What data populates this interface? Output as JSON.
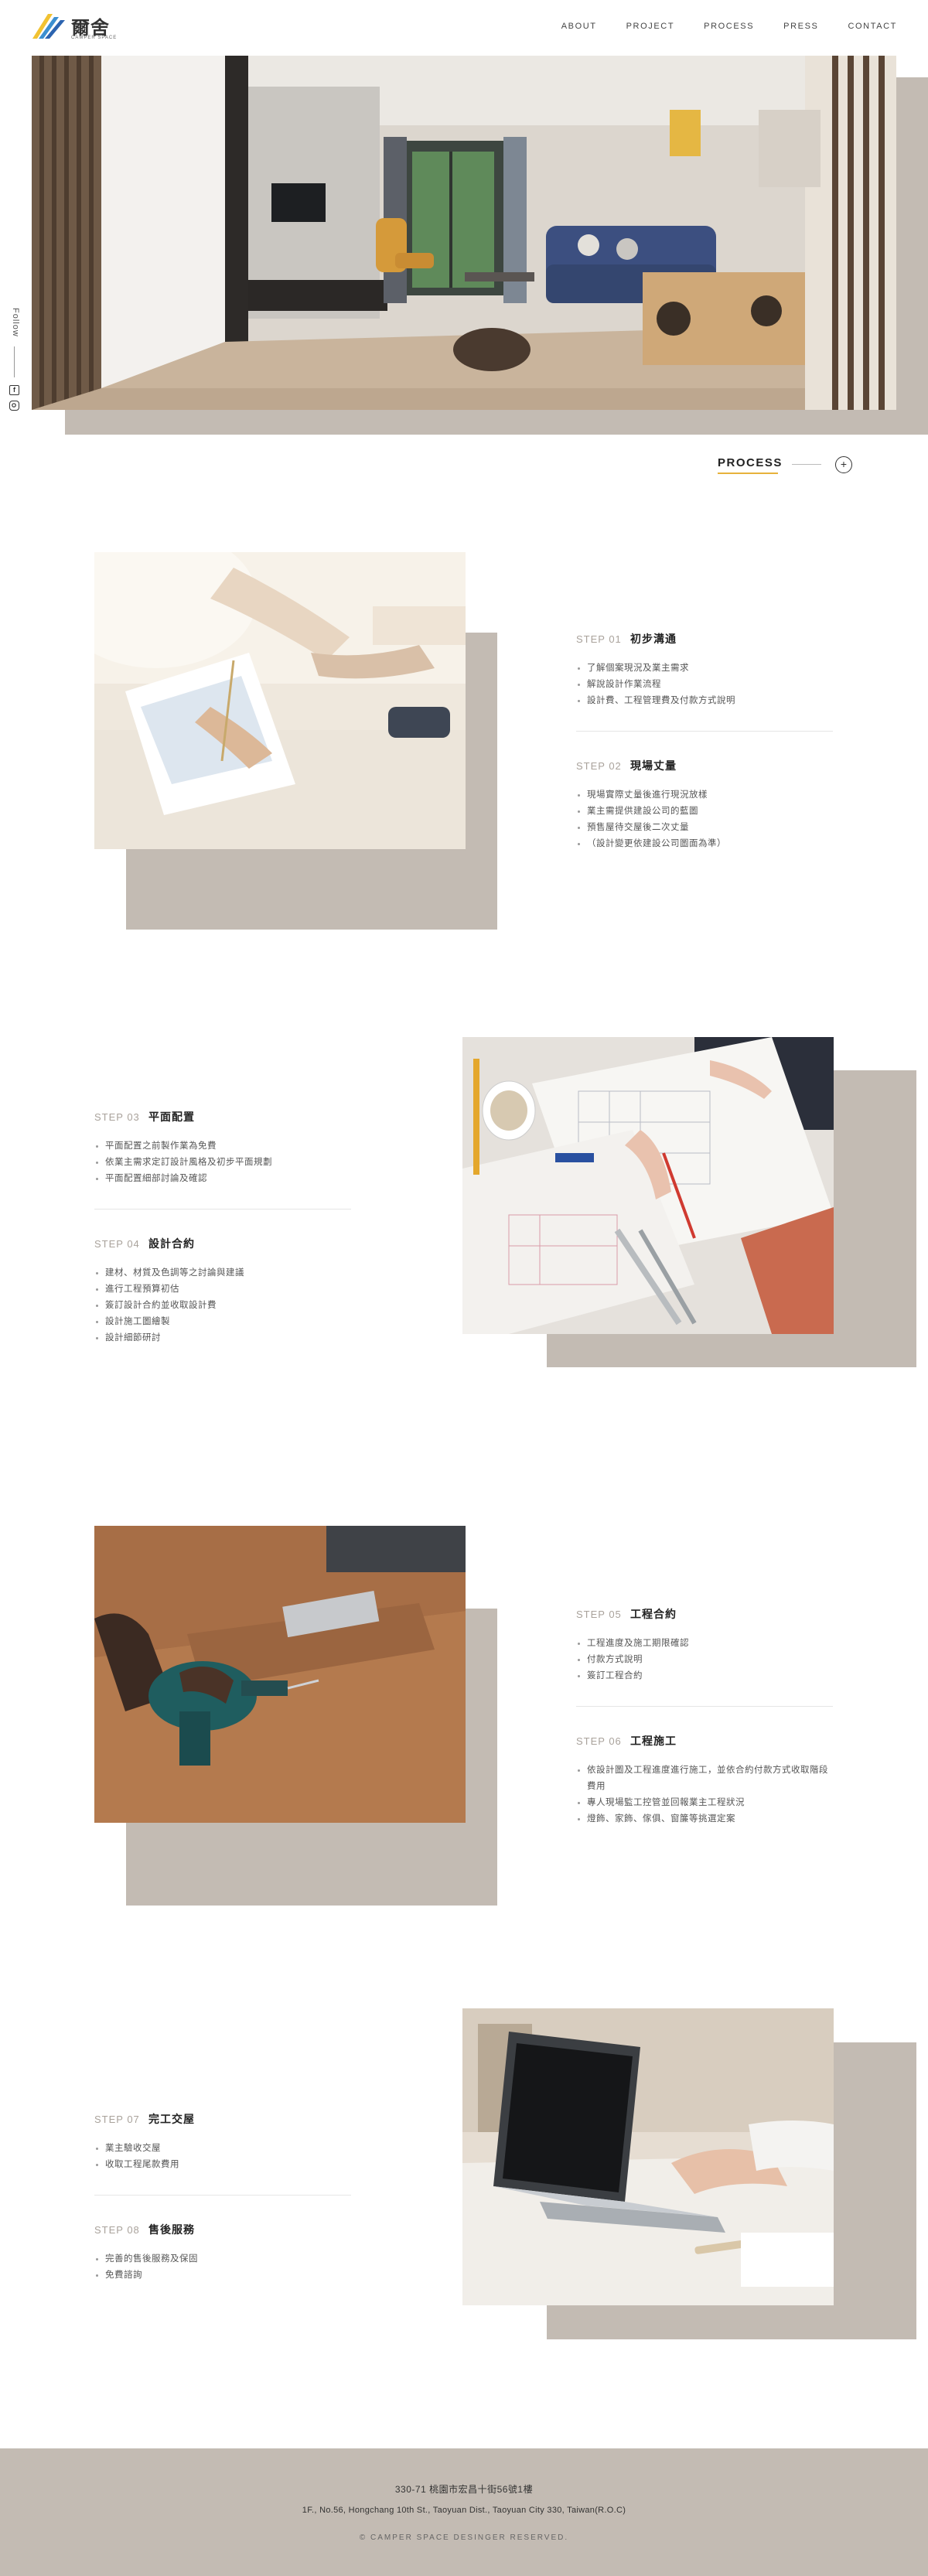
{
  "brand": {
    "name": "爾舍",
    "tagline": "CAMPER SPACE"
  },
  "nav": [
    "ABOUT",
    "PROJECT",
    "PROCESS",
    "PRESS",
    "CONTACT"
  ],
  "social": {
    "follow": "Follow"
  },
  "process": {
    "title": "PROCESS",
    "toggle": "+"
  },
  "blocks": [
    {
      "steps": [
        {
          "no": "STEP 01",
          "name": "初步溝通",
          "items": [
            "了解個案現況及業主需求",
            "解說設計作業流程",
            "設計費、工程管理費及付款方式說明"
          ]
        },
        {
          "no": "STEP 02",
          "name": "現場丈量",
          "items": [
            "現場實際丈量後進行現況放樣",
            "業主需提供建設公司的藍圖",
            "預售屋待交屋後二次丈量",
            "（設計變更依建設公司圖面為準）"
          ]
        }
      ]
    },
    {
      "steps": [
        {
          "no": "STEP 03",
          "name": "平面配置",
          "items": [
            "平面配置之前製作業為免費",
            "依業主需求定訂設計風格及初步平面規劃",
            "平面配置細部討論及確認"
          ]
        },
        {
          "no": "STEP 04",
          "name": "設計合約",
          "items": [
            "建材、材質及色調等之討論與建議",
            "進行工程預算初估",
            "簽訂設計合約並收取設計費",
            "設計施工圖繪製",
            "設計細節研討"
          ]
        }
      ]
    },
    {
      "steps": [
        {
          "no": "STEP 05",
          "name": "工程合約",
          "items": [
            "工程進度及施工期限確認",
            "付款方式說明",
            "簽訂工程合約"
          ]
        },
        {
          "no": "STEP 06",
          "name": "工程施工",
          "items": [
            "依設計圖及工程進度進行施工，並依合約付款方式收取階段費用",
            "專人現場監工控管並回報業主工程狀況",
            "燈飾、家飾、傢俱、窗簾等挑選定案"
          ]
        }
      ]
    },
    {
      "steps": [
        {
          "no": "STEP 07",
          "name": "完工交屋",
          "items": [
            "業主驗收交屋",
            "收取工程尾款費用"
          ]
        },
        {
          "no": "STEP 08",
          "name": "售後服務",
          "items": [
            "完善的售後服務及保固",
            "免費諮詢"
          ]
        }
      ]
    }
  ],
  "footer": {
    "address_zh": "330-71 桃園市宏昌十街56號1樓",
    "address_en": "1F., No.56, Hongchang 10th St., Taoyuan Dist., Taoyuan City 330, Taiwan(R.O.C)",
    "copyright": "© CAMPER SPACE DESINGER RESERVED."
  },
  "colors": {
    "accent": "#e7b23b",
    "shadow": "#c3bbb3",
    "step_no": "#a9a29b"
  }
}
